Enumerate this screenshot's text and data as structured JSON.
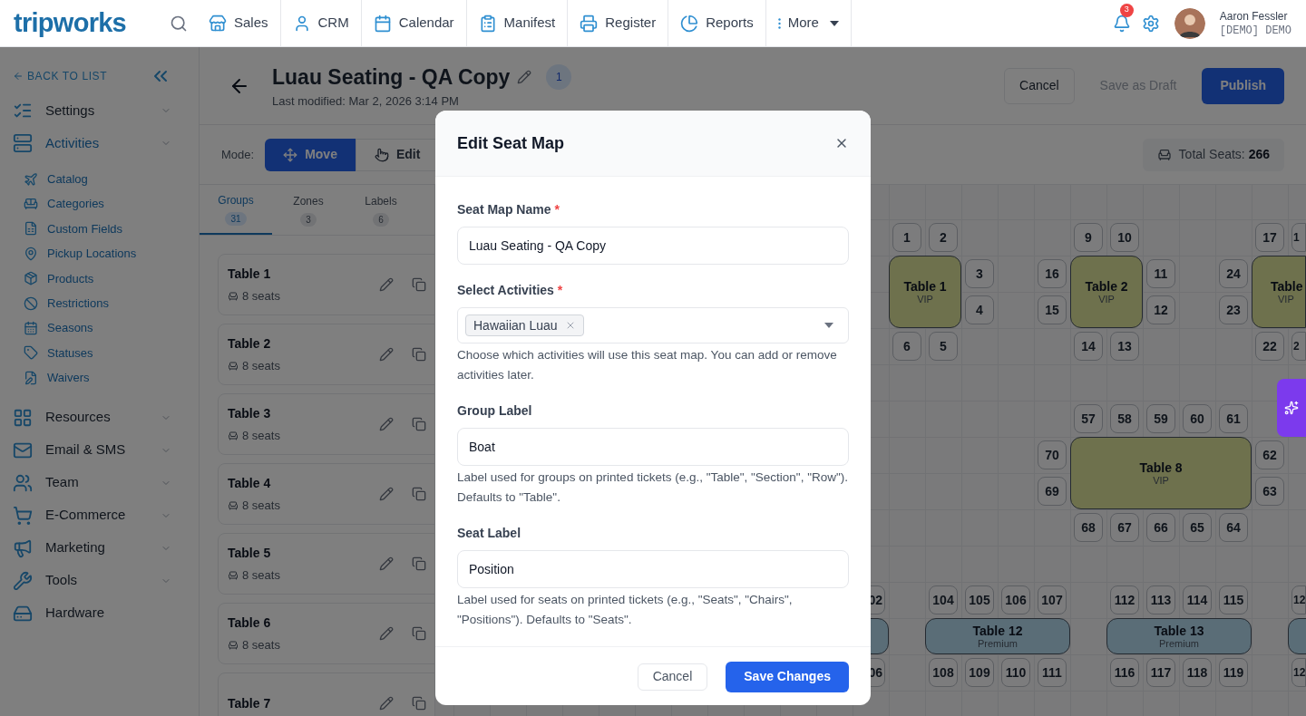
{
  "nav": {
    "logo": "tripworks",
    "items": [
      {
        "kind": "sales",
        "label": "Sales"
      },
      {
        "kind": "crm",
        "label": "CRM"
      },
      {
        "kind": "calendar",
        "label": "Calendar"
      },
      {
        "kind": "manifest",
        "label": "Manifest"
      },
      {
        "kind": "register",
        "label": "Register"
      },
      {
        "kind": "reports",
        "label": "Reports"
      },
      {
        "kind": "more",
        "label": "More"
      }
    ],
    "notification_count": "3",
    "user": {
      "name": "Aaron Fessler",
      "account": "[DEMO] DEMO"
    }
  },
  "sidebar": {
    "back": "BACK TO LIST",
    "sections": [
      {
        "kind": "group",
        "label": "Settings",
        "selected": false
      },
      {
        "kind": "group",
        "label": "Activities",
        "selected": true,
        "children": [
          {
            "label": "Catalog"
          },
          {
            "label": "Categories"
          },
          {
            "label": "Custom Fields"
          },
          {
            "label": "Pickup Locations"
          },
          {
            "label": "Products"
          },
          {
            "label": "Restrictions"
          },
          {
            "label": "Seasons"
          },
          {
            "label": "Statuses"
          },
          {
            "label": "Waivers"
          }
        ]
      },
      {
        "kind": "group",
        "label": "Resources",
        "selected": false
      },
      {
        "kind": "group",
        "label": "Email & SMS",
        "selected": false
      },
      {
        "kind": "group",
        "label": "Team",
        "selected": false
      },
      {
        "kind": "group",
        "label": "E-Commerce",
        "selected": false
      },
      {
        "kind": "group",
        "label": "Marketing",
        "selected": false
      },
      {
        "kind": "group",
        "label": "Tools",
        "selected": false
      },
      {
        "kind": "link",
        "label": "Hardware",
        "selected": false
      }
    ]
  },
  "header": {
    "title": "Luau Seating - QA Copy",
    "version": "1",
    "modified": "Last modified: Mar 2, 2026 3:14 PM",
    "buttons": [
      {
        "kind": "secondary",
        "label": "Cancel",
        "disabled": false
      },
      {
        "kind": "ghost",
        "label": "Save as Draft",
        "disabled": true
      },
      {
        "kind": "primary",
        "label": "Publish",
        "disabled": false
      }
    ]
  },
  "mode": {
    "label": "Mode:",
    "options": [
      {
        "kind": "move",
        "label": "Move",
        "selected": true
      },
      {
        "kind": "edit",
        "label": "Edit",
        "selected": false
      }
    ],
    "total_label": "Total Seats:",
    "total": "266"
  },
  "panel": {
    "tabs": [
      {
        "label": "Groups",
        "count": "31",
        "selected": true
      },
      {
        "label": "Zones",
        "count": "3",
        "selected": false
      },
      {
        "label": "Labels",
        "count": "6",
        "selected": false
      }
    ],
    "groups": [
      {
        "name": "Table 1",
        "seats": "8 seats"
      },
      {
        "name": "Table 2",
        "seats": "8 seats"
      },
      {
        "name": "Table 3",
        "seats": "8 seats"
      },
      {
        "name": "Table 4",
        "seats": "8 seats"
      },
      {
        "name": "Table 5",
        "seats": "8 seats"
      },
      {
        "name": "Table 6",
        "seats": "8 seats"
      },
      {
        "name": "Table 7"
      }
    ]
  },
  "canvas": {
    "tables": [
      {
        "kind": "vip",
        "name": "Table 1",
        "tier": "VIP"
      },
      {
        "kind": "vip",
        "name": "Table 2",
        "tier": "VIP"
      },
      {
        "kind": "vip",
        "name": "Table",
        "tier": "VIP"
      },
      {
        "kind": "vip",
        "name": "Table 8",
        "tier": "VIP"
      },
      {
        "kind": "premium"
      },
      {
        "kind": "premium",
        "name": "Table 12",
        "tier": "Premium"
      },
      {
        "kind": "premium",
        "name": "Table 13",
        "tier": "Premium"
      },
      {
        "kind": "premium"
      }
    ],
    "seats": [
      "1",
      "2",
      "9",
      "10",
      "17",
      "1",
      "3",
      "16",
      "11",
      "24",
      "4",
      "15",
      "12",
      "23",
      "6",
      "5",
      "14",
      "13",
      "22",
      "2",
      "57",
      "58",
      "59",
      "60",
      "61",
      "70",
      "62",
      "69",
      "63",
      "68",
      "67",
      "66",
      "65",
      "64",
      "02",
      "104",
      "105",
      "106",
      "107",
      "112",
      "113",
      "114",
      "115",
      "12",
      "06",
      "108",
      "109",
      "110",
      "111",
      "116",
      "117",
      "118",
      "119",
      "12"
    ]
  },
  "modal": {
    "title": "Edit Seat Map",
    "fields": [
      {
        "kind": "text",
        "label": "Seat Map Name",
        "required_mark": "*",
        "value": "Luau Seating - QA Copy"
      },
      {
        "kind": "multiselect",
        "label": "Select Activities",
        "required_mark": "*",
        "tags": [
          "Hawaiian Luau"
        ],
        "help": "Choose which activities will use this seat map. You can add or remove activities later."
      },
      {
        "kind": "text",
        "label": "Group Label",
        "value": "Boat",
        "help": "Label used for groups on printed tickets (e.g., \"Table\", \"Section\", \"Row\"). Defaults to \"Table\"."
      },
      {
        "kind": "text",
        "label": "Seat Label",
        "value": "Position",
        "help": "Label used for seats on printed tickets (e.g., \"Seats\", \"Chairs\", \"Positions\"). Defaults to \"Seats\"."
      }
    ],
    "buttons": [
      {
        "kind": "secondary",
        "label": "Cancel"
      },
      {
        "kind": "primary",
        "label": "Save Changes"
      }
    ]
  }
}
